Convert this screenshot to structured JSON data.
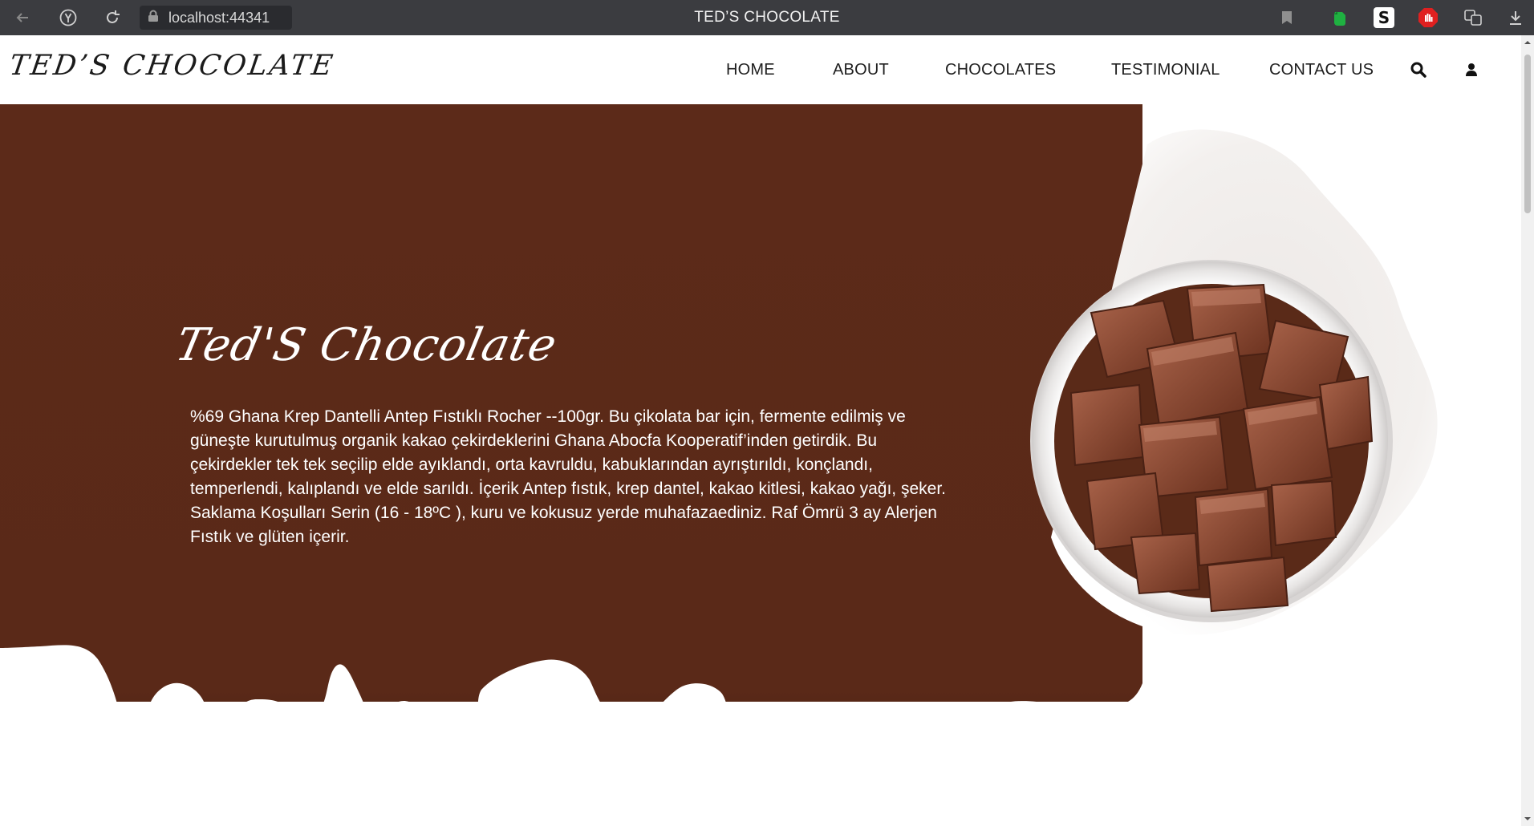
{
  "browser": {
    "url": "localhost:44341",
    "tab_title": "TED’S CHOCOLATE",
    "extensions": [
      "evernote-icon",
      "s-extension-icon",
      "adblock-icon",
      "translate-icon"
    ]
  },
  "header": {
    "logo": "TED’S CHOCOLATE",
    "nav": [
      "HOME",
      "ABOUT",
      "CHOCOLATES",
      "TESTIMONIAL",
      "CONTACT US"
    ]
  },
  "hero": {
    "title": "Ted'S Chocolate",
    "description": "%69 Ghana Krep Dantelli Antep Fıstıklı Rocher --100gr. Bu çikolata bar için, fermente edilmiş ve güneşte kurutulmuş organik kakao çekirdeklerini Ghana Abocfa Kooperatif’inden getirdik. Bu çekirdekler tek tek seçilip elde ayıklandı, orta kavruldu, kabuklarından ayrıştırıldı, konçlandı, temperlendi, kalıplandı ve elde sarıldı. İçerik Antep fıstık, krep dantel, kakao kitlesi, kakao yağı, şeker. Saklama Koşulları Serin (16 - 18ºC ), kuru ve kokusuz yerde muhafazaediniz. Raf Ömrü 3 ay Alerjen Fıstık ve glüten içerir."
  },
  "colors": {
    "hero_brown": "#5c2a19",
    "chrome_dark": "#3b3c40",
    "text_dark": "#1e1e1e"
  }
}
